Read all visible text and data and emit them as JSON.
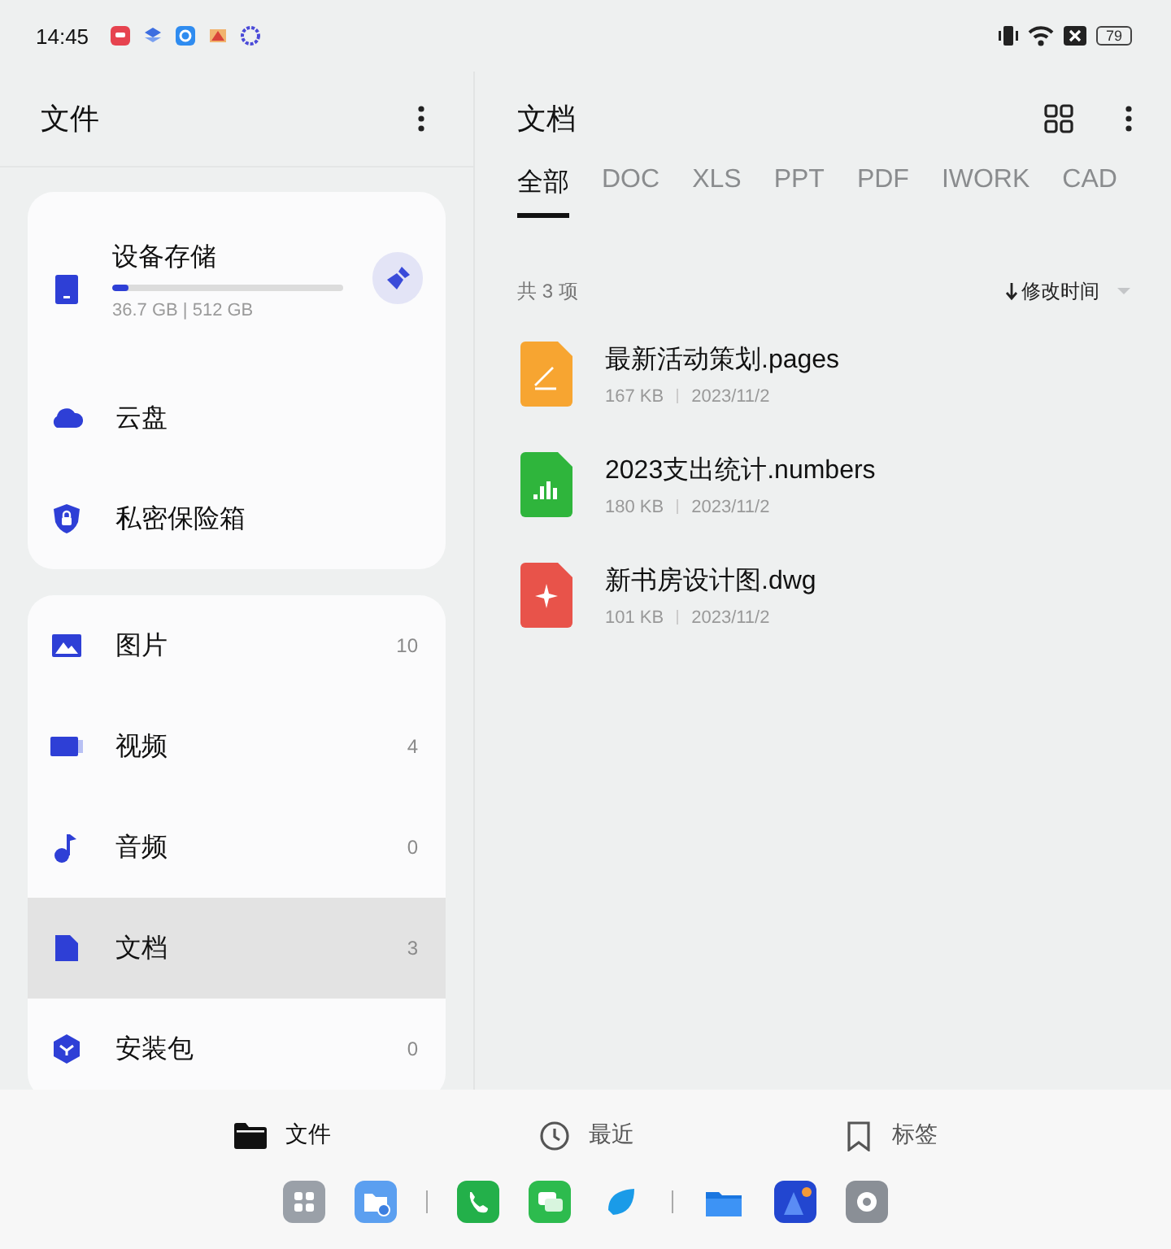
{
  "status_bar": {
    "time": "14:45",
    "battery": "79"
  },
  "sidebar": {
    "title": "文件",
    "storage": {
      "label": "设备存储",
      "level": 0.07,
      "reading": "36.7 GB | 512 GB"
    },
    "places": [
      {
        "label": "云盘",
        "kind": "cloud"
      },
      {
        "label": "私密保险箱",
        "kind": "safe"
      }
    ],
    "categories": [
      {
        "label": "图片",
        "count": "10",
        "kind": "image",
        "selected": false
      },
      {
        "label": "视频",
        "count": "4",
        "kind": "video",
        "selected": false
      },
      {
        "label": "音频",
        "count": "0",
        "kind": "audio",
        "selected": false
      },
      {
        "label": "文档",
        "count": "3",
        "kind": "doc",
        "selected": true
      },
      {
        "label": "安装包",
        "count": "0",
        "kind": "package",
        "selected": false
      }
    ]
  },
  "main": {
    "title": "文档",
    "tabs": [
      {
        "label": "全部",
        "selected": true
      },
      {
        "label": "DOC",
        "selected": false
      },
      {
        "label": "XLS",
        "selected": false
      },
      {
        "label": "PPT",
        "selected": false
      },
      {
        "label": "PDF",
        "selected": false
      },
      {
        "label": "IWORK",
        "selected": false
      },
      {
        "label": "CAD",
        "selected": false
      }
    ],
    "count": "共 3 项",
    "sort": "修改时间",
    "files": [
      {
        "name": "最新活动策划.pages",
        "size": "167 KB",
        "date": "2023/11/2",
        "kind": "pages"
      },
      {
        "name": "2023支出统计.numbers",
        "size": "180 KB",
        "date": "2023/11/2",
        "kind": "numbers"
      },
      {
        "name": "新书房设计图.dwg",
        "size": "101 KB",
        "date": "2023/11/2",
        "kind": "dwg"
      }
    ]
  },
  "bottom_nav": [
    {
      "label": "文件",
      "kind": "files",
      "selected": true
    },
    {
      "label": "最近",
      "kind": "recent",
      "selected": false
    },
    {
      "label": "标签",
      "kind": "tags",
      "selected": false
    }
  ]
}
